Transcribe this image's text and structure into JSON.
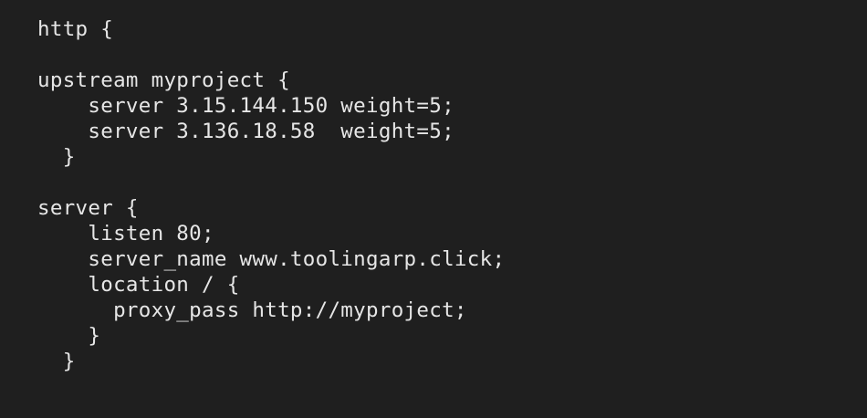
{
  "editor": {
    "background": "#1f1f1f",
    "text_color": "#e6e6e6",
    "lines": [
      "http {",
      "",
      "upstream myproject {",
      "    server 3.15.144.150 weight=5;",
      "    server 3.136.18.58  weight=5;",
      "  }",
      "",
      "server {",
      "    listen 80;",
      "    server_name www.toolingarp.click;",
      "    location / {",
      "      proxy_pass http://myproject;",
      "    }",
      "  }"
    ]
  }
}
